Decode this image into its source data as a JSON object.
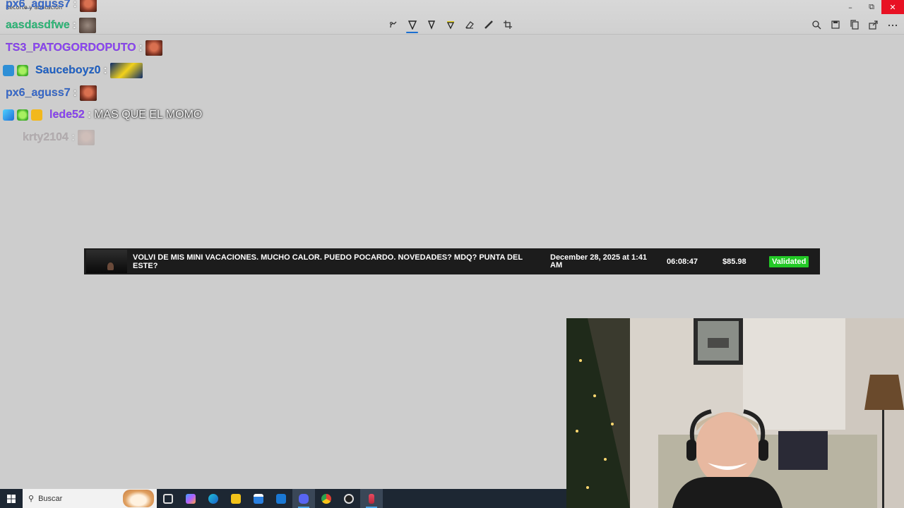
{
  "app": {
    "title": "Recorte y anotación",
    "window_controls": {
      "minimize": "–",
      "restore": "⧉",
      "close": "✕"
    }
  },
  "toolbar": {
    "center_icons": [
      "touch-write-icon",
      "ballpoint-pen-icon",
      "pencil-icon",
      "highlighter-icon",
      "eraser-icon",
      "ruler-icon",
      "crop-icon"
    ],
    "right_icons": [
      "zoom-icon",
      "save-icon",
      "copy-icon",
      "share-icon",
      "more-options-icon"
    ]
  },
  "chat": {
    "messages": [
      {
        "user": "px6_aguss7",
        "color": "#3a6fd6",
        "sep": ":",
        "emote": "face",
        "text": ""
      },
      {
        "user": "aasdasdfwe",
        "color": "#2ec27e",
        "sep": ":",
        "emote": "grey",
        "text": ""
      },
      {
        "user": "TS3_PATOGORDOPUTO",
        "color": "#9146ff",
        "sep": ":",
        "emote": "face",
        "text": ""
      },
      {
        "user": "Sauceboyz0",
        "color": "#1f66d1",
        "sep": ":",
        "emote": "wide",
        "text": "",
        "badges": [
          "sub-badge-icon",
          "sparkle-badge-icon"
        ]
      },
      {
        "user": "px6_aguss7",
        "color": "#3a6fd6",
        "sep": ":",
        "emote": "face",
        "text": ""
      },
      {
        "user": "lede52",
        "color": "#9146ff",
        "sep": ":",
        "emote": "",
        "text": "MAS QUE EL MOMO",
        "badges": [
          "cube-badge-icon",
          "sparkle-badge-icon",
          "crown-badge-icon"
        ]
      },
      {
        "user": "krty2104",
        "color": "#9a8a90",
        "sep": ":",
        "emote": "faded",
        "text": ""
      }
    ]
  },
  "donation": {
    "message": "VOLVI DE MIS MINI VACACIONES. MUCHO CALOR. PUEDO POCARDO. NOVEDADES? MDQ? PUNTA DEL ESTE?",
    "date": "December 28, 2025 at 1:41 AM",
    "time": "06:08:47",
    "amount": "$85.98",
    "status": "Validated",
    "status_color": "#23c926"
  },
  "taskbar": {
    "search_placeholder": "Buscar",
    "icons": [
      "task-view-icon",
      "copilot-icon",
      "edge-icon",
      "file-explorer-icon",
      "store-icon",
      "mail-icon",
      "discord-icon",
      "chrome-icon",
      "obs-icon",
      "snipping-tool-icon"
    ]
  }
}
